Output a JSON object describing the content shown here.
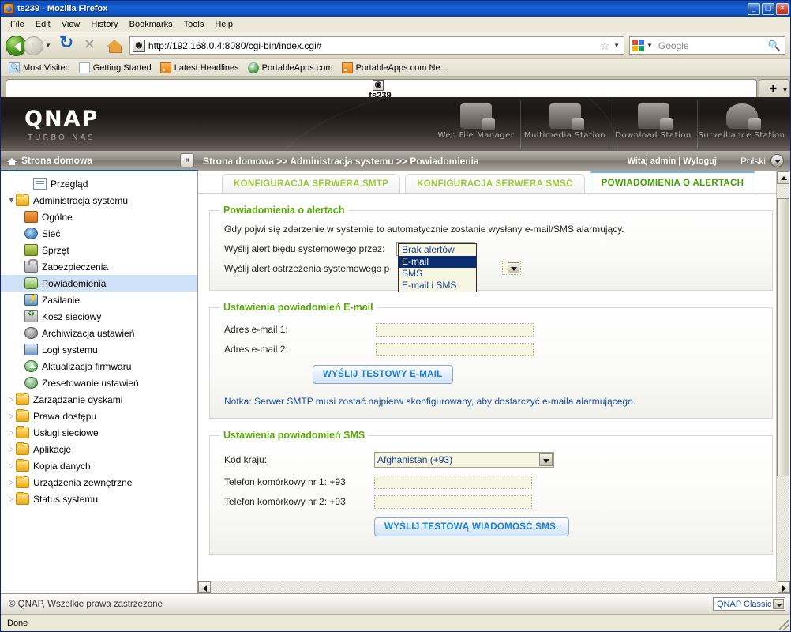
{
  "window": {
    "title": "ts239 - Mozilla Firefox",
    "icon": "firefox-icon",
    "minimize": "_",
    "maximize": "□",
    "close": "✕"
  },
  "menubar": {
    "items": [
      "File",
      "Edit",
      "View",
      "History",
      "Bookmarks",
      "Tools",
      "Help"
    ]
  },
  "navbar": {
    "back_tooltip": "Back",
    "forward_tooltip": "Forward",
    "reload_tooltip": "Reload",
    "stop_tooltip": "Stop",
    "home_tooltip": "Home",
    "url": "http://192.168.0.4:8080/cgi-bin/index.cgi#",
    "search_placeholder": "Google"
  },
  "bookmarks": [
    {
      "label": "Most Visited",
      "icon": "most-visited-icon"
    },
    {
      "label": "Getting Started",
      "icon": "document-icon"
    },
    {
      "label": "Latest Headlines",
      "icon": "rss-icon"
    },
    {
      "label": "PortableApps.com",
      "icon": "portableapps-icon"
    },
    {
      "label": "PortableApps.com Ne...",
      "icon": "rss-icon"
    }
  ],
  "browser_tabs": {
    "tabs": [
      {
        "label": "ts239",
        "icon": "qnap-favicon",
        "active": true
      }
    ],
    "new_tab_label": "✚",
    "list_all_label": "▾"
  },
  "qnap_header": {
    "logo": "QNAP",
    "subtitle": "TURBO NAS",
    "stations": [
      {
        "label": "Web File Manager",
        "icon": "web-file-manager-icon"
      },
      {
        "label": "Multimedia Station",
        "icon": "multimedia-station-icon"
      },
      {
        "label": "Download Station",
        "icon": "download-station-icon"
      },
      {
        "label": "Surveillance Station",
        "icon": "surveillance-station-icon"
      }
    ]
  },
  "sidebar": {
    "header": "Strona domowa",
    "collapse_label": "«",
    "items": [
      {
        "label": "Przegląd",
        "level": 2,
        "twisty": "",
        "icon": "overview-icon",
        "icon_class": "doc",
        "selected": false
      },
      {
        "label": "Administracja systemu",
        "level": 1,
        "twisty": "▼",
        "icon": "folder-icon",
        "icon_class": "folder",
        "selected": false
      },
      {
        "label": "Ogólne",
        "level": 2,
        "twisty": "",
        "icon": "general-icon",
        "icon_class": "gen",
        "selected": false
      },
      {
        "label": "Sieć",
        "level": 2,
        "twisty": "",
        "icon": "network-icon",
        "icon_class": "net",
        "selected": false
      },
      {
        "label": "Sprzęt",
        "level": 2,
        "twisty": "",
        "icon": "hardware-icon",
        "icon_class": "hw",
        "selected": false
      },
      {
        "label": "Zabezpieczenia",
        "level": 2,
        "twisty": "",
        "icon": "lock-icon",
        "icon_class": "lock",
        "selected": false
      },
      {
        "label": "Powiadomienia",
        "level": 2,
        "twisty": "",
        "icon": "notification-icon",
        "icon_class": "bell",
        "selected": true
      },
      {
        "label": "Zasilanie",
        "level": 2,
        "twisty": "",
        "icon": "power-icon",
        "icon_class": "pwr",
        "selected": false
      },
      {
        "label": "Kosz sieciowy",
        "level": 2,
        "twisty": "",
        "icon": "recycle-bin-icon",
        "icon_class": "bin",
        "selected": false
      },
      {
        "label": "Archiwizacja ustawień",
        "level": 2,
        "twisty": "",
        "icon": "backup-icon",
        "icon_class": "arch",
        "selected": false
      },
      {
        "label": "Logi systemu",
        "level": 2,
        "twisty": "",
        "icon": "system-logs-icon",
        "icon_class": "log",
        "selected": false
      },
      {
        "label": "Aktualizacja firmwaru",
        "level": 2,
        "twisty": "",
        "icon": "firmware-update-icon",
        "icon_class": "up",
        "selected": false
      },
      {
        "label": "Zresetowanie ustawień",
        "level": 2,
        "twisty": "",
        "icon": "reset-icon",
        "icon_class": "reset",
        "selected": false
      },
      {
        "label": "Zarządzanie dyskami",
        "level": 1,
        "twisty": "▷",
        "icon": "folder-icon",
        "icon_class": "folder",
        "selected": false
      },
      {
        "label": "Prawa dostępu",
        "level": 1,
        "twisty": "▷",
        "icon": "folder-icon",
        "icon_class": "folder",
        "selected": false
      },
      {
        "label": "Usługi sieciowe",
        "level": 1,
        "twisty": "▷",
        "icon": "folder-icon",
        "icon_class": "folder",
        "selected": false
      },
      {
        "label": "Aplikacje",
        "level": 1,
        "twisty": "▷",
        "icon": "folder-icon",
        "icon_class": "folder",
        "selected": false
      },
      {
        "label": "Kopia danych",
        "level": 1,
        "twisty": "▷",
        "icon": "folder-icon",
        "icon_class": "folder",
        "selected": false
      },
      {
        "label": "Urządzenia zewnętrzne",
        "level": 1,
        "twisty": "▷",
        "icon": "folder-icon",
        "icon_class": "folder",
        "selected": false
      },
      {
        "label": "Status systemu",
        "level": 1,
        "twisty": "▷",
        "icon": "folder-icon",
        "icon_class": "folder",
        "selected": false
      }
    ]
  },
  "breadcrumb": {
    "path": "Strona domowa >> Administracja systemu >> Powiadomienia",
    "user_greeting": "Witaj admin | Wyloguj",
    "language": "Polski"
  },
  "main": {
    "tabs": [
      {
        "label": "KONFIGURACJA SERWERA SMTP",
        "active": false
      },
      {
        "label": "KONFIGURACJA SERWERA SMSC",
        "active": false
      },
      {
        "label": "POWIADOMIENIA O ALERTACH",
        "active": true
      }
    ],
    "alert_panel": {
      "legend": "Powiadomienia o alertach",
      "description": "Gdy pojwi się zdarzenie w systemie to automatycznie zostanie wysłany e-mail/SMS alarmujący.",
      "error_label": "Wyślij alert błędu systemowego przez:",
      "error_value": "E-mail",
      "warning_label": "Wyślij alert ostrzeżenia systemowego p",
      "options": [
        "Brak alertów",
        "E-mail",
        "SMS",
        "E-mail i SMS"
      ],
      "selected_option": "E-mail",
      "dropdown_open": true
    },
    "email_panel": {
      "legend": "Ustawienia powiadomień E-mail",
      "email1_label": "Adres e-mail 1:",
      "email1_value": "",
      "email2_label": "Adres e-mail 2:",
      "email2_value": "",
      "test_button": "WYŚLIJ TESTOWY E-MAIL",
      "note": "Notka: Serwer SMTP musi zostać najpierw skonfigurowany, aby dostarczyć e-maila alarmującego."
    },
    "sms_panel": {
      "legend": "Ustawienia powiadomień SMS",
      "country_label": "Kod kraju:",
      "country_value": "Afghanistan (+93)",
      "phone1_label": "Telefon komórkowy nr 1: +93",
      "phone1_value": "",
      "phone2_label": "Telefon komórkowy nr 2: +93",
      "phone2_value": "",
      "test_button": "WYŚLIJ TESTOWĄ WIADOMOŚĆ SMS."
    }
  },
  "qnap_footer": {
    "copyright": "© QNAP, Wszelkie prawa zastrzeżone",
    "theme": "QNAP Classic"
  },
  "statusbar": {
    "text": "Done"
  },
  "colors": {
    "accent_green": "#5aa90a",
    "tab_green": "#9fcb3b",
    "link_blue": "#1b4f9e",
    "select_blue": "#0b2d72",
    "titlebar_blue": "#0a4ab0"
  }
}
